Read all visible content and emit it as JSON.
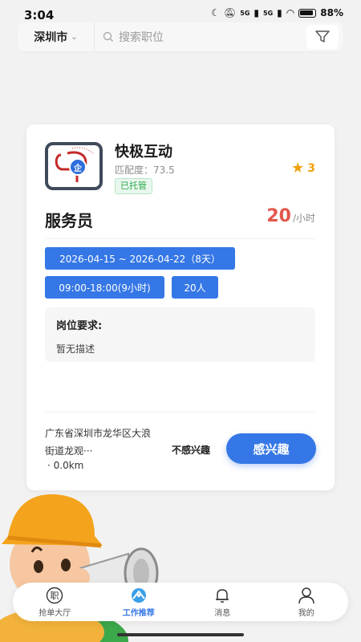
{
  "status_bar": {
    "time": "3:04",
    "network1": "5G",
    "network2": "5G",
    "battery": "88%"
  },
  "search": {
    "city": "深圳市",
    "placeholder": "搜索职位"
  },
  "job_card": {
    "company": "快极互动",
    "match_score": "匹配度：73.5",
    "managed_badge": "已托管",
    "enterprise_badge": "企",
    "rating": "3",
    "title": "服务员",
    "salary_amount": "20",
    "salary_unit": "/小时",
    "date_range": "2026-04-15 ~ 2026-04-22（8天）",
    "time_range": "09:00-18:00(9小时)",
    "headcount": "20人",
    "requirements_title": "岗位要求:",
    "requirements_text": "暂无描述",
    "address": "广东省深圳市龙华区大浪街道龙观···",
    "distance": "· 0.0km",
    "not_interested": "不感兴趣",
    "interested": "感兴趣"
  },
  "tabs": [
    {
      "label": "抢单大厅",
      "icon": "job-hall-icon"
    },
    {
      "label": "工作推荐",
      "icon": "recommend-icon",
      "active": true
    },
    {
      "label": "消息",
      "icon": "bell-icon"
    },
    {
      "label": "我的",
      "icon": "user-icon"
    }
  ],
  "colors": {
    "accent": "#3577e6",
    "salary": "#e2574c",
    "star": "#f0a10f",
    "managed": "#2ba84a"
  }
}
